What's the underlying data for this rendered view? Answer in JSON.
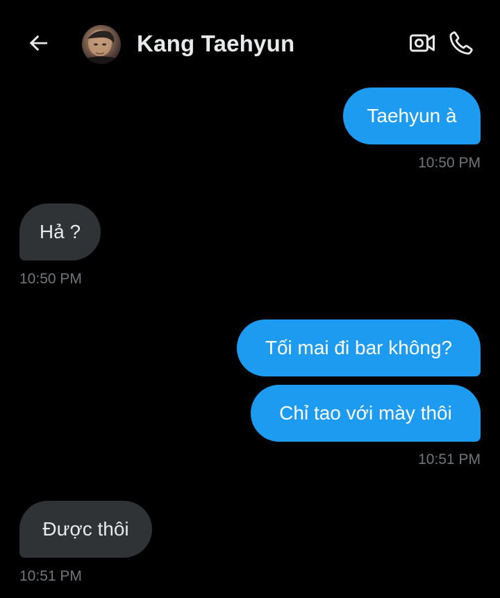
{
  "header": {
    "contact_name": "Kang Taehyun"
  },
  "messages": [
    {
      "direction": "outgoing",
      "text": "Taehyun à"
    },
    {
      "direction": "outgoing",
      "time": "10:50 PM"
    },
    {
      "direction": "incoming",
      "text": "Hả ?"
    },
    {
      "direction": "incoming",
      "time": "10:50 PM"
    },
    {
      "direction": "outgoing",
      "text": "Tối mai đi bar không?"
    },
    {
      "direction": "outgoing",
      "text": "Chỉ tao với mày thôi"
    },
    {
      "direction": "outgoing",
      "time": "10:51 PM"
    },
    {
      "direction": "incoming",
      "text": "Được thôi"
    },
    {
      "direction": "incoming",
      "time": "10:51 PM"
    }
  ],
  "icons": {
    "back": "arrow-left-icon",
    "video": "video-camera-icon",
    "call": "phone-icon"
  },
  "colors": {
    "background": "#000000",
    "outgoing_bubble": "#1d9bf0",
    "incoming_bubble": "#2f3336",
    "timestamp": "#71767b"
  }
}
